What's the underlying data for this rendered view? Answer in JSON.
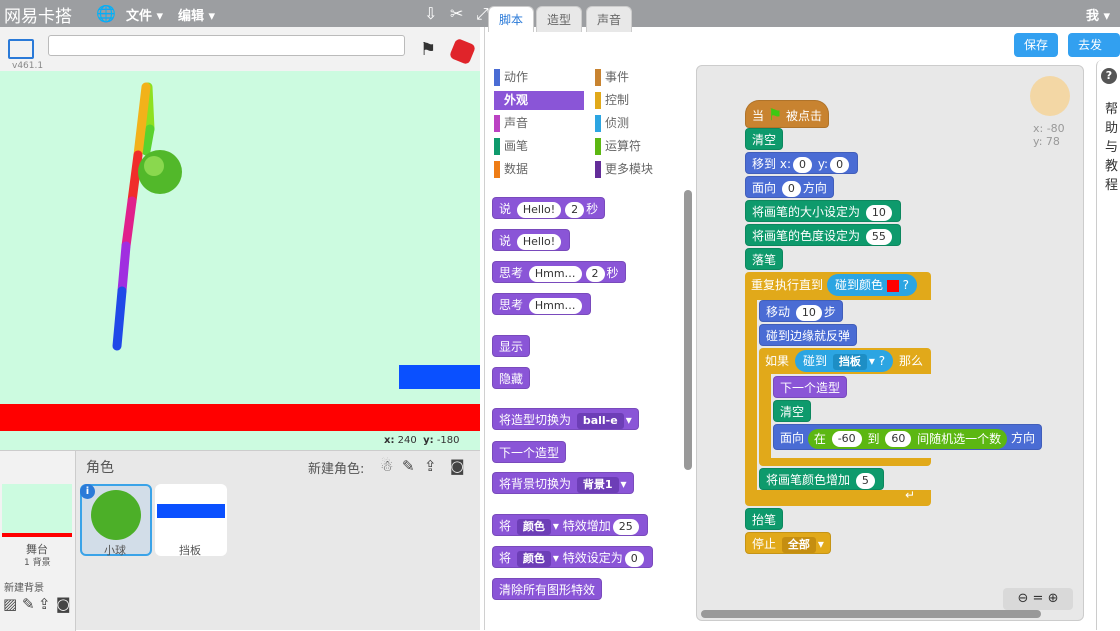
{
  "topbar": {
    "logo": "网易卡搭",
    "menu_file": "文件",
    "menu_edit": "编辑",
    "user": "我"
  },
  "stage": {
    "version": "v461.1",
    "title_value": "",
    "x_label": "x:",
    "x_value": "240",
    "y_label": "y:",
    "y_value": "-180"
  },
  "sprites_panel": {
    "header": "角色",
    "new_sprite": "新建角色:",
    "stage_label": "舞台",
    "stage_sub": "1 背景",
    "new_backdrop": "新建背景",
    "sprites": [
      {
        "name": "小球"
      },
      {
        "name": "挡板"
      }
    ]
  },
  "tabs": [
    "脚本",
    "造型",
    "声音"
  ],
  "buttons": {
    "save": "保存",
    "publish": "去发布"
  },
  "categories": [
    {
      "label": "动作",
      "color": "#4a6cd4"
    },
    {
      "label": "事件",
      "color": "#c88330"
    },
    {
      "label": "外观",
      "color": "#8a55d7"
    },
    {
      "label": "控制",
      "color": "#e1a91a"
    },
    {
      "label": "声音",
      "color": "#bb42c3"
    },
    {
      "label": "侦测",
      "color": "#2ca5e2"
    },
    {
      "label": "画笔",
      "color": "#0e9a6c"
    },
    {
      "label": "运算符",
      "color": "#5cb712"
    },
    {
      "label": "数据",
      "color": "#ee7d16"
    },
    {
      "label": "更多模块",
      "color": "#632d99"
    }
  ],
  "palette": {
    "say_secs": {
      "pre": "说",
      "text": "Hello!",
      "num": "2",
      "post": "秒"
    },
    "say": {
      "pre": "说",
      "text": "Hello!"
    },
    "think_secs": {
      "pre": "思考",
      "text": "Hmm…",
      "num": "2",
      "post": "秒"
    },
    "think": {
      "pre": "思考",
      "text": "Hmm…"
    },
    "show": "显示",
    "hide": "隐藏",
    "switch_costume": {
      "pre": "将造型切换为",
      "val": "ball-e"
    },
    "next_costume": "下一个造型",
    "switch_backdrop": {
      "pre": "将背景切换为",
      "val": "背景1"
    },
    "change_effect": {
      "pre": "将",
      "val": "颜色",
      "mid": "特效增加",
      "num": "25"
    },
    "set_effect": {
      "pre": "将",
      "val": "颜色",
      "mid": "特效设定为",
      "num": "0"
    },
    "clear_effects": "清除所有图形特效"
  },
  "script": {
    "hat": {
      "pre": "当",
      "post": "被点击"
    },
    "clear": "清空",
    "goto": {
      "pre": "移到",
      "xl": "x:",
      "x": "0",
      "yl": "y:",
      "y": "0"
    },
    "point": {
      "pre": "面向",
      "val": "0",
      "post": "方向"
    },
    "set_size": {
      "pre": "将画笔的大小设定为",
      "val": "10"
    },
    "set_hue": {
      "pre": "将画笔的色度设定为",
      "val": "55"
    },
    "pen_down": "落笔",
    "repeat_until": {
      "pre": "重复执行直到",
      "touch": "碰到颜色",
      "q": "?"
    },
    "move": {
      "pre": "移动",
      "val": "10",
      "post": "步"
    },
    "bounce": "碰到边缘就反弹",
    "if": {
      "pre": "如果",
      "touch": "碰到",
      "obj": "挡板",
      "q": "?",
      "post": "那么"
    },
    "next_costume": "下一个造型",
    "clear2": "清空",
    "point_random": {
      "pre": "面向",
      "in": "在",
      "a": "-60",
      "to": "到",
      "b": "60",
      "rand": "间随机选一个数",
      "post": "方向"
    },
    "change_pen": {
      "pre": "将画笔颜色增加",
      "val": "5"
    },
    "pen_up": "抬笔",
    "stop": {
      "pre": "停止",
      "val": "全部"
    },
    "coord_x": "x: -80",
    "coord_y": "y: 78"
  },
  "help": [
    "帮",
    "助",
    "与",
    "教",
    "程"
  ],
  "colors": {
    "stage_bg": "#ccfbe0",
    "red": "#ff0000",
    "blue": "#0a50ff"
  }
}
